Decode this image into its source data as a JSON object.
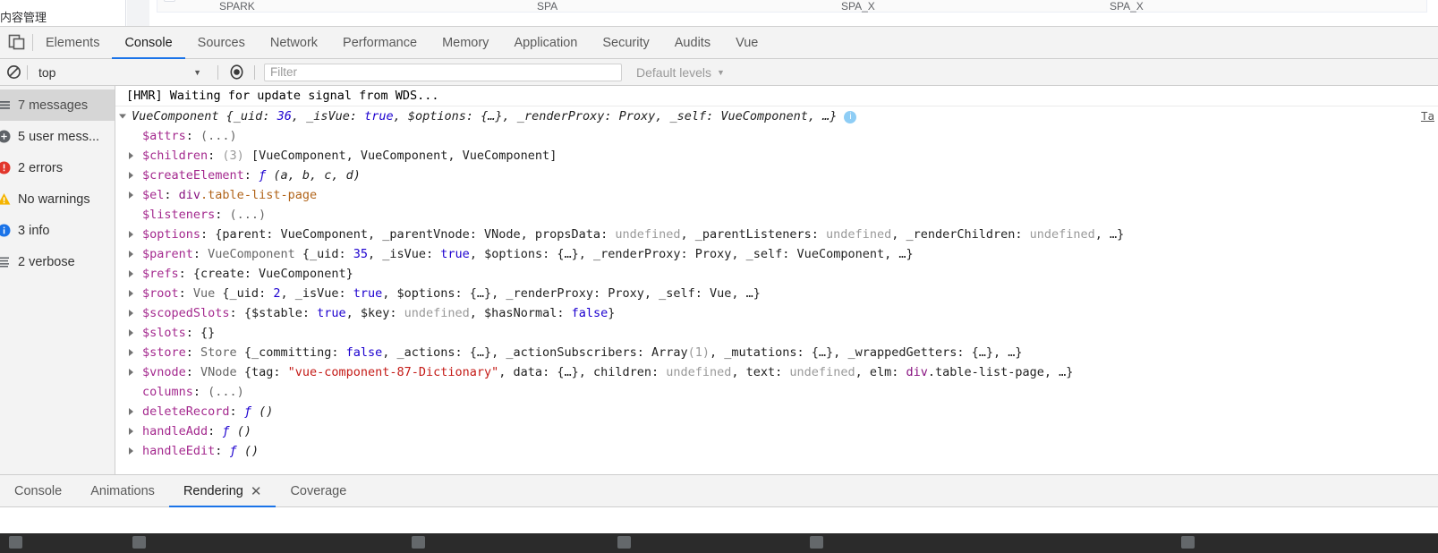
{
  "underlying_page": {
    "sidebar_label": "内容管理",
    "table_headers": [
      "SPARK",
      "SPA",
      "SPA_X",
      "SPA_X"
    ]
  },
  "main_tabs": [
    {
      "label": "Elements",
      "selected": false
    },
    {
      "label": "Console",
      "selected": true
    },
    {
      "label": "Sources",
      "selected": false
    },
    {
      "label": "Network",
      "selected": false
    },
    {
      "label": "Performance",
      "selected": false
    },
    {
      "label": "Memory",
      "selected": false
    },
    {
      "label": "Application",
      "selected": false
    },
    {
      "label": "Security",
      "selected": false
    },
    {
      "label": "Audits",
      "selected": false
    },
    {
      "label": "Vue",
      "selected": false
    }
  ],
  "toolbar": {
    "clear_icon": "clear-console-icon",
    "context_value": "top",
    "eye_icon": "live-expression-eye-icon",
    "filter_value": "",
    "filter_placeholder": "Filter",
    "levels_label": "Default levels",
    "caret": "▼"
  },
  "sidebar": {
    "items": [
      {
        "label": "7 messages",
        "icon": "messages-list-icon",
        "selected": true,
        "color": "#5f6368"
      },
      {
        "label": "5 user mess...",
        "icon": "user-message-icon",
        "selected": false,
        "color": "#5f6368"
      },
      {
        "label": "2 errors",
        "icon": "error-circle-icon",
        "selected": false,
        "color": "#e2362b"
      },
      {
        "label": "No warnings",
        "icon": "warning-triangle-icon",
        "selected": false,
        "color": "#f5b400"
      },
      {
        "label": "3 info",
        "icon": "info-circle-icon",
        "selected": false,
        "color": "#1a73e8"
      },
      {
        "label": "2 verbose",
        "icon": "verbose-icon",
        "selected": false,
        "color": "#5f6368"
      }
    ]
  },
  "console": {
    "hmr_message": "[HMR] Waiting for update signal from WDS...",
    "source_link": "Ta",
    "info_badge": "i",
    "object_header": {
      "ctor": "VueComponent",
      "preview": " {_uid: 36, _isVue: true, $options: {…}, _renderProxy: Proxy, _self: VueComponent, …}",
      "uid_value": "36",
      "isvue_value": "true"
    },
    "properties": [
      {
        "name": "$attrs",
        "expandable": false,
        "value_html": "(...)",
        "kind": "ellipsis"
      },
      {
        "name": "$children",
        "expandable": true,
        "value_html": "(3) [VueComponent, VueComponent, VueComponent]",
        "kind": "array",
        "count": "(3)"
      },
      {
        "name": "$createElement",
        "expandable": true,
        "value_html": "ƒ (a, b, c, d)",
        "kind": "function"
      },
      {
        "name": "$el",
        "expandable": true,
        "value_html": "div.table-list-page",
        "kind": "node"
      },
      {
        "name": "$listeners",
        "expandable": false,
        "value_html": "(...)",
        "kind": "ellipsis"
      },
      {
        "name": "$options",
        "expandable": true,
        "value_html": "{parent: VueComponent, _parentVnode: VNode, propsData: undefined, _parentListeners: undefined, _renderChildren: undefined, …}",
        "kind": "object"
      },
      {
        "name": "$parent",
        "expandable": true,
        "value_html": "VueComponent {_uid: 35, _isVue: true, $options: {…}, _renderProxy: Proxy, _self: VueComponent, …}",
        "kind": "object"
      },
      {
        "name": "$refs",
        "expandable": true,
        "value_html": "{create: VueComponent}",
        "kind": "object"
      },
      {
        "name": "$root",
        "expandable": true,
        "value_html": "Vue {_uid: 2, _isVue: true, $options: {…}, _renderProxy: Proxy, _self: Vue, …}",
        "kind": "object"
      },
      {
        "name": "$scopedSlots",
        "expandable": true,
        "value_html": "{$stable: true, $key: undefined, $hasNormal: false}",
        "kind": "object"
      },
      {
        "name": "$slots",
        "expandable": true,
        "value_html": "{}",
        "kind": "object"
      },
      {
        "name": "$store",
        "expandable": true,
        "value_html": "Store {_committing: false, _actions: {…}, _actionSubscribers: Array(1), _mutations: {…}, _wrappedGetters: {…}, …}",
        "kind": "object"
      },
      {
        "name": "$vnode",
        "expandable": true,
        "value_html": "VNode {tag: \"vue-component-87-Dictionary\", data: {…}, children: undefined, text: undefined, elm: div.table-list-page, …}",
        "kind": "object"
      },
      {
        "name": "columns",
        "expandable": false,
        "value_html": "(...)",
        "kind": "ellipsis"
      },
      {
        "name": "deleteRecord",
        "expandable": true,
        "value_html": "ƒ ()",
        "kind": "function"
      },
      {
        "name": "handleAdd",
        "expandable": true,
        "value_html": "ƒ ()",
        "kind": "function"
      },
      {
        "name": "handleEdit",
        "expandable": true,
        "value_html": "ƒ ()",
        "kind": "function"
      }
    ]
  },
  "drawer_tabs": [
    {
      "label": "Console",
      "selected": false,
      "closable": false
    },
    {
      "label": "Animations",
      "selected": false,
      "closable": false
    },
    {
      "label": "Rendering",
      "selected": true,
      "closable": true,
      "close_glyph": "✕"
    },
    {
      "label": "Coverage",
      "selected": false,
      "closable": false
    }
  ],
  "colors": {
    "accent": "#1a73e8",
    "toolbar_bg": "#f3f3f3",
    "error": "#e2362b",
    "warning": "#f5b400",
    "string": "#c41a16",
    "number": "#1c00cf",
    "propkey": "#a4298e",
    "nodetag": "#881280",
    "nodeclass": "#b1641a"
  }
}
